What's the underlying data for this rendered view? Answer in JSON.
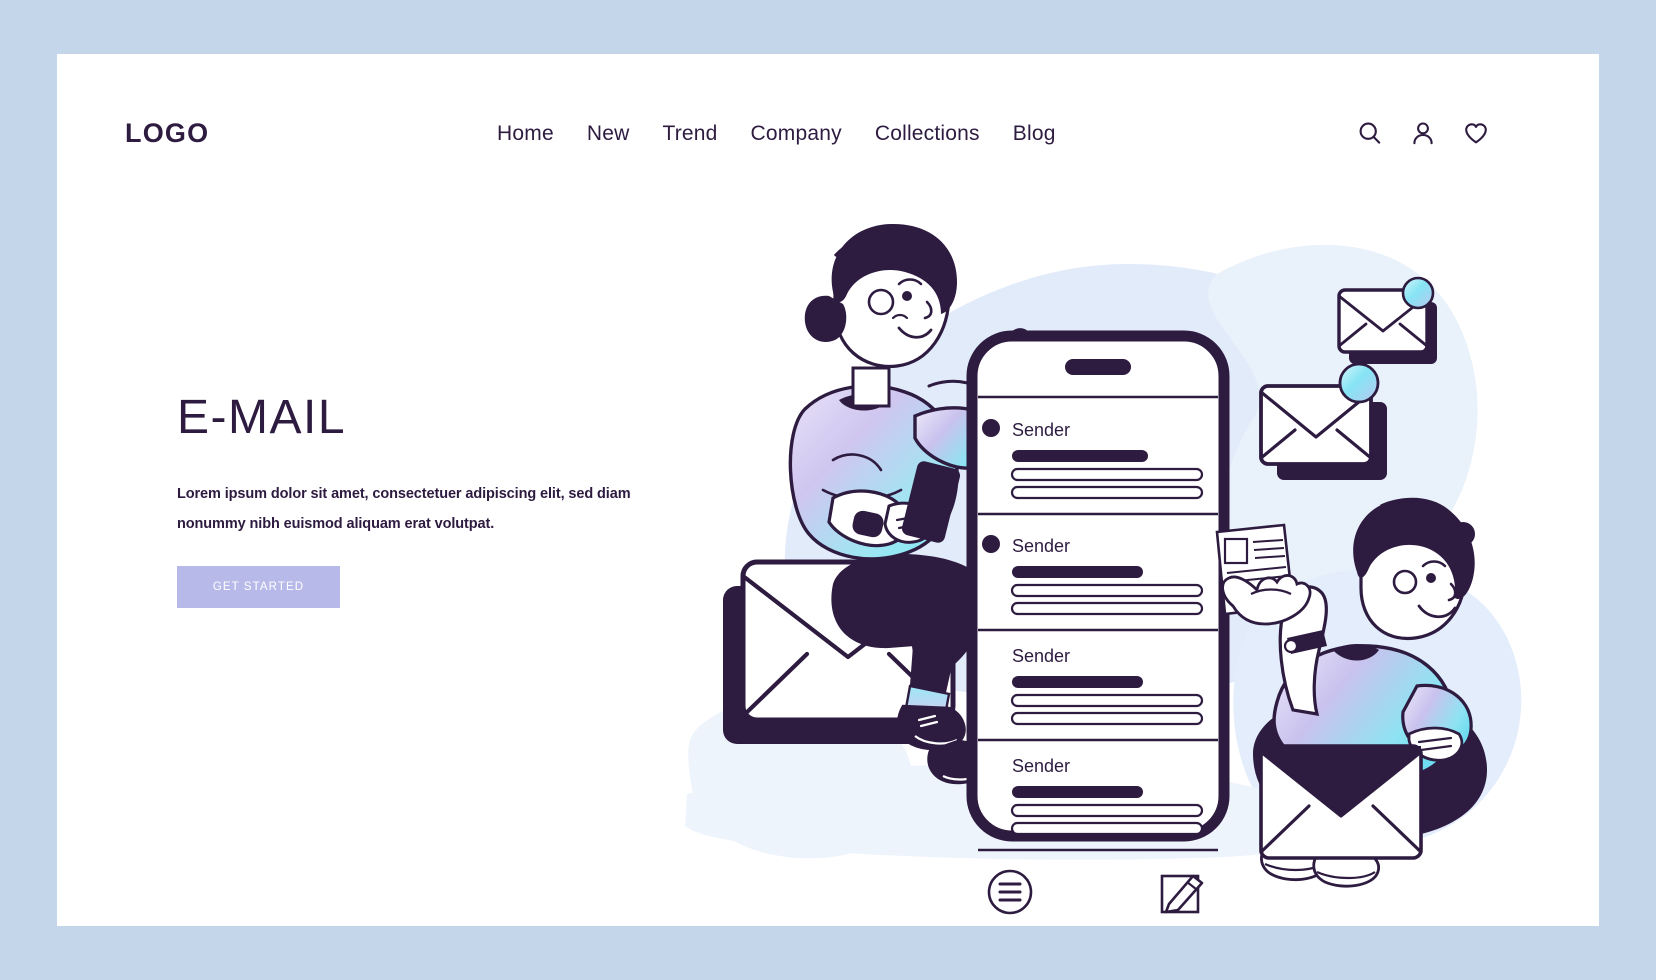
{
  "theme": {
    "page_background": "#c3d6ea",
    "card_background": "#ffffff",
    "ink": "#2d1b40",
    "accent_button": "#b7bae8",
    "blob_blue": "#e2ebfa",
    "blob_blue_soft": "#eef4fc",
    "gradient_cyan": "#7fe8f5",
    "gradient_lavender": "#cfc6f0"
  },
  "header": {
    "logo": "LOGO",
    "nav_items": [
      {
        "label": "Home"
      },
      {
        "label": "New"
      },
      {
        "label": "Trend"
      },
      {
        "label": "Company"
      },
      {
        "label": "Collections"
      },
      {
        "label": "Blog"
      }
    ],
    "icons": [
      {
        "name": "search-icon",
        "label": "Search"
      },
      {
        "name": "user-icon",
        "label": "Account"
      },
      {
        "name": "heart-icon",
        "label": "Favorites"
      }
    ]
  },
  "hero": {
    "title": "E-MAIL",
    "paragraph": "Lorem ipsum dolor sit amet, consectetuer adipiscing elit, sed diam nonummy nibh euismod aliquam erat volutpat.",
    "cta_label": "GET STARTED"
  },
  "illustration": {
    "phone": {
      "emails": [
        {
          "sender": "Sender",
          "unread": true
        },
        {
          "sender": "Sender",
          "unread": true
        },
        {
          "sender": "Sender",
          "unread": false
        },
        {
          "sender": "Sender",
          "unread": false
        }
      ],
      "toolbar": [
        {
          "name": "menu-icon",
          "label": "Menu"
        },
        {
          "name": "compose-icon",
          "label": "Compose"
        }
      ]
    },
    "envelopes": [
      {
        "name": "envelope-top-right",
        "badge": true
      },
      {
        "name": "envelope-mid-right",
        "badge": true
      },
      {
        "name": "envelope-under-woman",
        "badge": false
      },
      {
        "name": "envelope-held-by-man",
        "badge": false
      }
    ],
    "people": [
      {
        "name": "woman-with-phone"
      },
      {
        "name": "man-with-envelope"
      }
    ],
    "document": {
      "name": "document-sheet"
    }
  }
}
